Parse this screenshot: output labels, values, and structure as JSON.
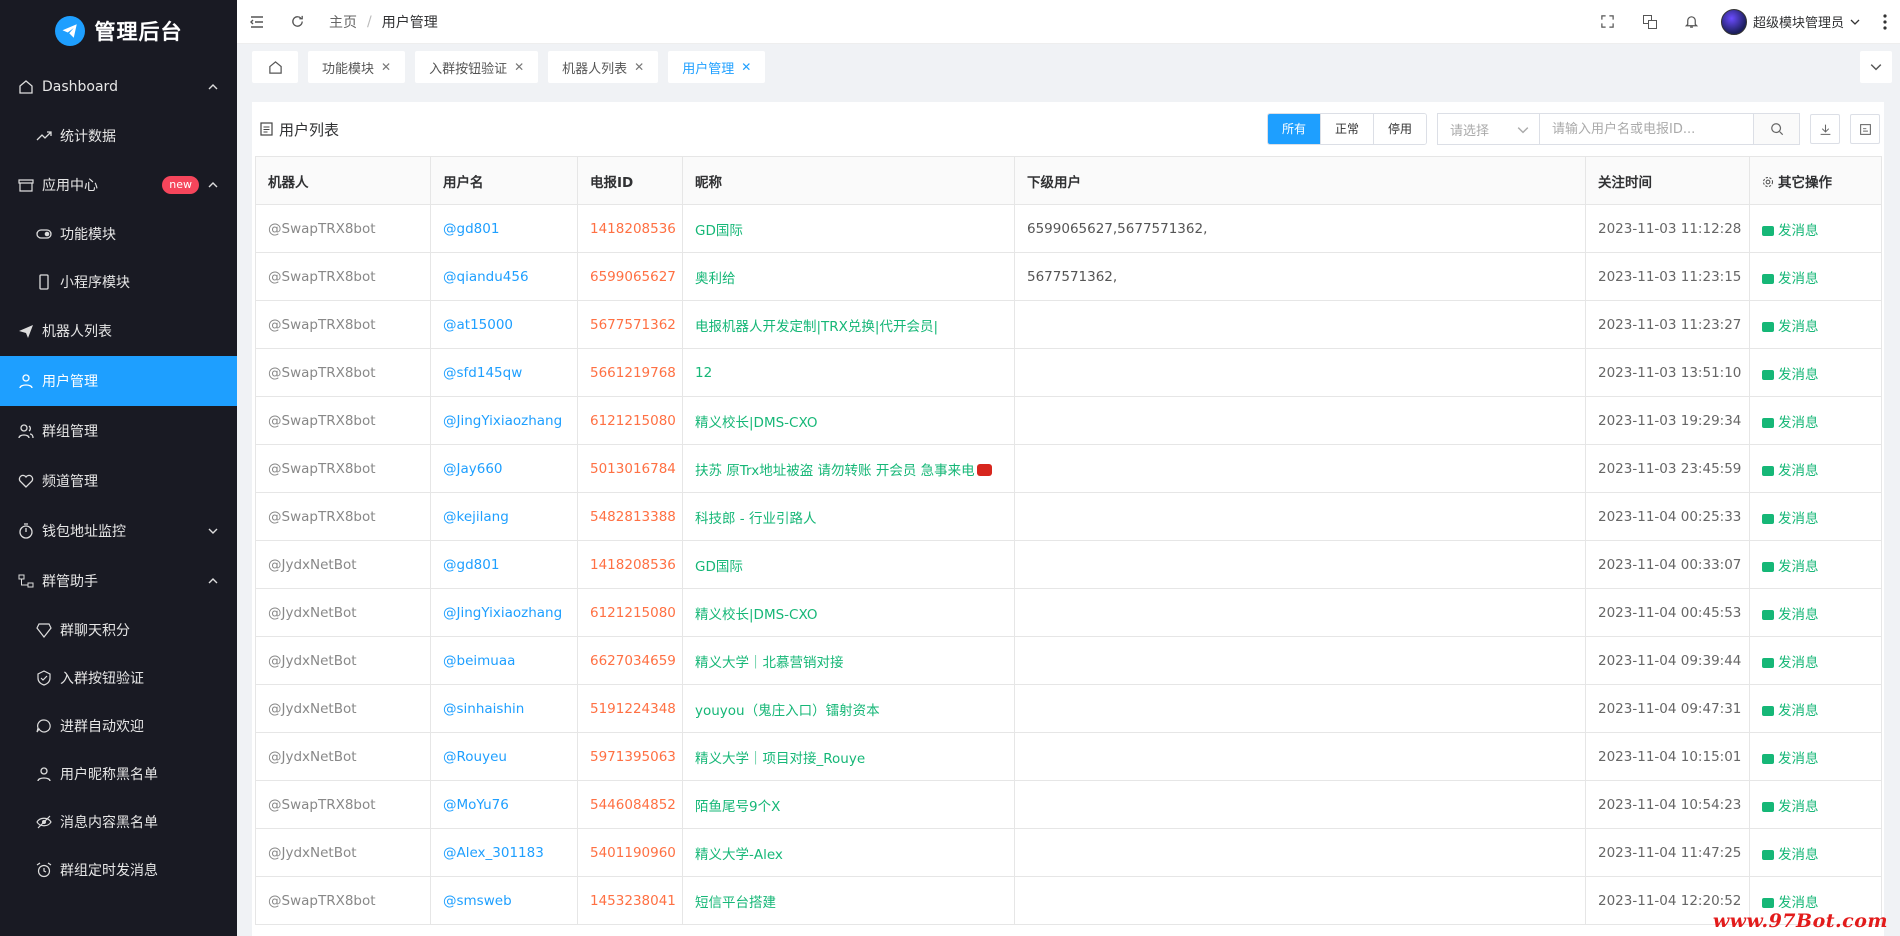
{
  "app": {
    "title": "管理后台"
  },
  "sidebar": {
    "items": [
      {
        "label": "Dashboard",
        "type": "group",
        "icon": "home-icon",
        "expanded": true
      },
      {
        "label": "统计数据",
        "type": "sub",
        "icon": "trend-icon"
      },
      {
        "label": "应用中心",
        "type": "group",
        "icon": "store-icon",
        "expanded": true,
        "badge": "new"
      },
      {
        "label": "功能模块",
        "type": "sub",
        "icon": "toggle-icon"
      },
      {
        "label": "小程序模块",
        "type": "sub",
        "icon": "phone-icon"
      },
      {
        "label": "机器人列表",
        "type": "item",
        "icon": "send-icon"
      },
      {
        "label": "用户管理",
        "type": "item",
        "icon": "user-icon",
        "active": true
      },
      {
        "label": "群组管理",
        "type": "item",
        "icon": "users-icon"
      },
      {
        "label": "频道管理",
        "type": "item",
        "icon": "heart-icon"
      },
      {
        "label": "钱包地址监控",
        "type": "group",
        "icon": "timer-icon",
        "expanded": false
      },
      {
        "label": "群管助手",
        "type": "group",
        "icon": "flow-icon",
        "expanded": true
      },
      {
        "label": "群聊天积分",
        "type": "sub",
        "icon": "diamond-icon"
      },
      {
        "label": "入群按钮验证",
        "type": "sub",
        "icon": "shield-icon"
      },
      {
        "label": "进群自动欢迎",
        "type": "sub",
        "icon": "chat-icon"
      },
      {
        "label": "用户昵称黑名单",
        "type": "sub",
        "icon": "person-icon"
      },
      {
        "label": "消息内容黑名单",
        "type": "sub",
        "icon": "eye-off-icon"
      },
      {
        "label": "群组定时发消息",
        "type": "sub",
        "icon": "alarm-icon"
      }
    ]
  },
  "header": {
    "breadcrumb": {
      "home": "主页",
      "current": "用户管理"
    },
    "user_name": "超级模块管理员"
  },
  "tabs": [
    {
      "label": "功能模块",
      "active": false
    },
    {
      "label": "入群按钮验证",
      "active": false
    },
    {
      "label": "机器人列表",
      "active": false
    },
    {
      "label": "用户管理",
      "active": true
    }
  ],
  "card": {
    "title": "用户列表",
    "filters": [
      "所有",
      "正常",
      "停用"
    ],
    "active_filter": 0,
    "select_placeholder": "请选择",
    "search_placeholder": "请输入用户名或电报ID..."
  },
  "table": {
    "columns": [
      "机器人",
      "用户名",
      "电报ID",
      "昵称",
      "下级用户",
      "关注时间",
      "其它操作"
    ],
    "action_label": "发消息",
    "rows": [
      [
        "@SwapTRX8bot",
        "@gd801",
        "1418208536",
        "GD国际",
        "6599065627,5677571362,",
        "2023-11-03 11:12:28"
      ],
      [
        "@SwapTRX8bot",
        "@qiandu456",
        "6599065627",
        "奥利给",
        "5677571362,",
        "2023-11-03 11:23:15"
      ],
      [
        "@SwapTRX8bot",
        "@at15000",
        "5677571362",
        "电报机器人开发定制|TRX兑换|代开会员|",
        "",
        "2023-11-03 11:23:27"
      ],
      [
        "@SwapTRX8bot",
        "@sfd145qw",
        "5661219768",
        "12",
        "",
        "2023-11-03 13:51:10"
      ],
      [
        "@SwapTRX8bot",
        "@JingYixiaozhang",
        "6121215080",
        "精义校长|DMS-CXO",
        "",
        "2023-11-03 19:29:34"
      ],
      [
        "@SwapTRX8bot",
        "@Jay660",
        "5013016784",
        "扶苏 原Trx地址被盗 请勿转账 开会员 急事来电",
        "",
        "2023-11-03 23:45:59"
      ],
      [
        "@SwapTRX8bot",
        "@kejilang",
        "5482813388",
        "科技郎 - 行业引路人",
        "",
        "2023-11-04 00:25:33"
      ],
      [
        "@JydxNetBot",
        "@gd801",
        "1418208536",
        "GD国际",
        "",
        "2023-11-04 00:33:07"
      ],
      [
        "@JydxNetBot",
        "@JingYixiaozhang",
        "6121215080",
        "精义校长|DMS-CXO",
        "",
        "2023-11-04 00:45:53"
      ],
      [
        "@JydxNetBot",
        "@beimuaa",
        "6627034659",
        "精义大学｜北慕营销对接",
        "",
        "2023-11-04 09:39:44"
      ],
      [
        "@JydxNetBot",
        "@sinhaishin",
        "5191224348",
        "youyou（鬼庄入口）镭射资本",
        "",
        "2023-11-04 09:47:31"
      ],
      [
        "@JydxNetBot",
        "@Rouyeu",
        "5971395063",
        "精义大学｜项目对接_Rouye",
        "",
        "2023-11-04 10:15:01"
      ],
      [
        "@SwapTRX8bot",
        "@MoYu76",
        "5446084852",
        "陌鱼尾号9个X",
        "",
        "2023-11-04 10:54:23"
      ],
      [
        "@JydxNetBot",
        "@Alex_301183",
        "5401190960",
        "精义大学-Alex",
        "",
        "2023-11-04 11:47:25"
      ],
      [
        "@SwapTRX8bot",
        "@smsweb",
        "1453238041",
        "短信平台搭建",
        "",
        "2023-11-04 12:20:52"
      ]
    ]
  },
  "watermark": "www.97Bot.com",
  "colors": {
    "sidebar_bg": "#191a23",
    "accent": "#1e9fff",
    "green": "#16b777",
    "orange": "#ff7043",
    "badge_red": "#f5455b"
  }
}
